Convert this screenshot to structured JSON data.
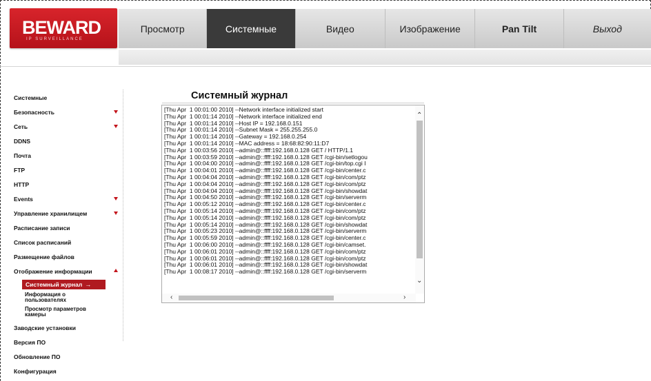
{
  "brand": {
    "name": "BEWARD",
    "tagline": "IP SURVEILLANCE"
  },
  "nav": {
    "items": [
      {
        "label": "Просмотр"
      },
      {
        "label": "Системные"
      },
      {
        "label": "Видео"
      },
      {
        "label": "Изображение"
      },
      {
        "label": "Pan Tilt"
      },
      {
        "label": "Выход"
      }
    ],
    "active": "Системные"
  },
  "sidebar": {
    "items": [
      {
        "label": "Системные"
      },
      {
        "label": "Безопасность",
        "expander": "down"
      },
      {
        "label": "Сеть",
        "expander": "down"
      },
      {
        "label": "DDNS"
      },
      {
        "label": "Почта"
      },
      {
        "label": "FTP"
      },
      {
        "label": "HTTP"
      },
      {
        "label": "Events",
        "expander": "down"
      },
      {
        "label": "Управление хранилищем",
        "expander": "down"
      },
      {
        "label": "Расписание записи"
      },
      {
        "label": "Список расписаний"
      },
      {
        "label": "Размещение файлов"
      },
      {
        "label": "Отображение информации",
        "expander": "up"
      },
      {
        "label": "Заводские установки"
      },
      {
        "label": "Версия ПО"
      },
      {
        "label": "Обновление ПО"
      },
      {
        "label": "Конфигурация"
      }
    ],
    "submenu": {
      "active": "Системный журнал",
      "active_arrow": "→",
      "items": [
        {
          "label": "Информация о пользователях"
        },
        {
          "label": "Просмотр параметров камеры"
        }
      ]
    }
  },
  "main": {
    "title": "Системный журнал",
    "log_lines": [
      "[Thu Apr  1 00:01:00 2010] --Network interface initialized start",
      "[Thu Apr  1 00:01:14 2010] --Network interface initialized end",
      "[Thu Apr  1 00:01:14 2010] --Host IP = 192.168.0.151",
      "[Thu Apr  1 00:01:14 2010] --Subnet Mask = 255.255.255.0",
      "[Thu Apr  1 00:01:14 2010] --Gateway = 192.168.0.254",
      "[Thu Apr  1 00:01:14 2010] --MAC address = 18:68:82:90:11:D7",
      "[Thu Apr  1 00:03:56 2010] --admin@::ffff:192.168.0.128 GET / HTTP/1.1",
      "[Thu Apr  1 00:03:59 2010] --admin@::ffff:192.168.0.128 GET /cgi-bin/setlogou",
      "[Thu Apr  1 00:04:00 2010] --admin@::ffff:192.168.0.128 GET /cgi-bin/top.cgi I",
      "[Thu Apr  1 00:04:01 2010] --admin@::ffff:192.168.0.128 GET /cgi-bin/center.c",
      "[Thu Apr  1 00:04:04 2010] --admin@::ffff:192.168.0.128 GET /cgi-bin/com/ptz",
      "[Thu Apr  1 00:04:04 2010] --admin@::ffff:192.168.0.128 GET /cgi-bin/com/ptz",
      "[Thu Apr  1 00:04:04 2010] --admin@::ffff:192.168.0.128 GET /cgi-bin/showdat",
      "[Thu Apr  1 00:04:50 2010] --admin@::ffff:192.168.0.128 GET /cgi-bin/serverm",
      "[Thu Apr  1 00:05:12 2010] --admin@::ffff:192.168.0.128 GET /cgi-bin/center.c",
      "[Thu Apr  1 00:05:14 2010] --admin@::ffff:192.168.0.128 GET /cgi-bin/com/ptz",
      "[Thu Apr  1 00:05:14 2010] --admin@::ffff:192.168.0.128 GET /cgi-bin/com/ptz",
      "[Thu Apr  1 00:05:14 2010] --admin@::ffff:192.168.0.128 GET /cgi-bin/showdat",
      "[Thu Apr  1 00:05:23 2010] --admin@::ffff:192.168.0.128 GET /cgi-bin/serverm",
      "[Thu Apr  1 00:05:59 2010] --admin@::ffff:192.168.0.128 GET /cgi-bin/center.c",
      "[Thu Apr  1 00:06:00 2010] --admin@::ffff:192.168.0.128 GET /cgi-bin/camset.",
      "[Thu Apr  1 00:06:01 2010] --admin@::ffff:192.168.0.128 GET /cgi-bin/com/ptz",
      "[Thu Apr  1 00:06:01 2010] --admin@::ffff:192.168.0.128 GET /cgi-bin/com/ptz",
      "[Thu Apr  1 00:06:01 2010] --admin@::ffff:192.168.0.128 GET /cgi-bin/showdat",
      "[Thu Apr  1 00:08:17 2010] --admin@::ffff:192.168.0.128 GET /cgi-bin/serverm"
    ]
  }
}
